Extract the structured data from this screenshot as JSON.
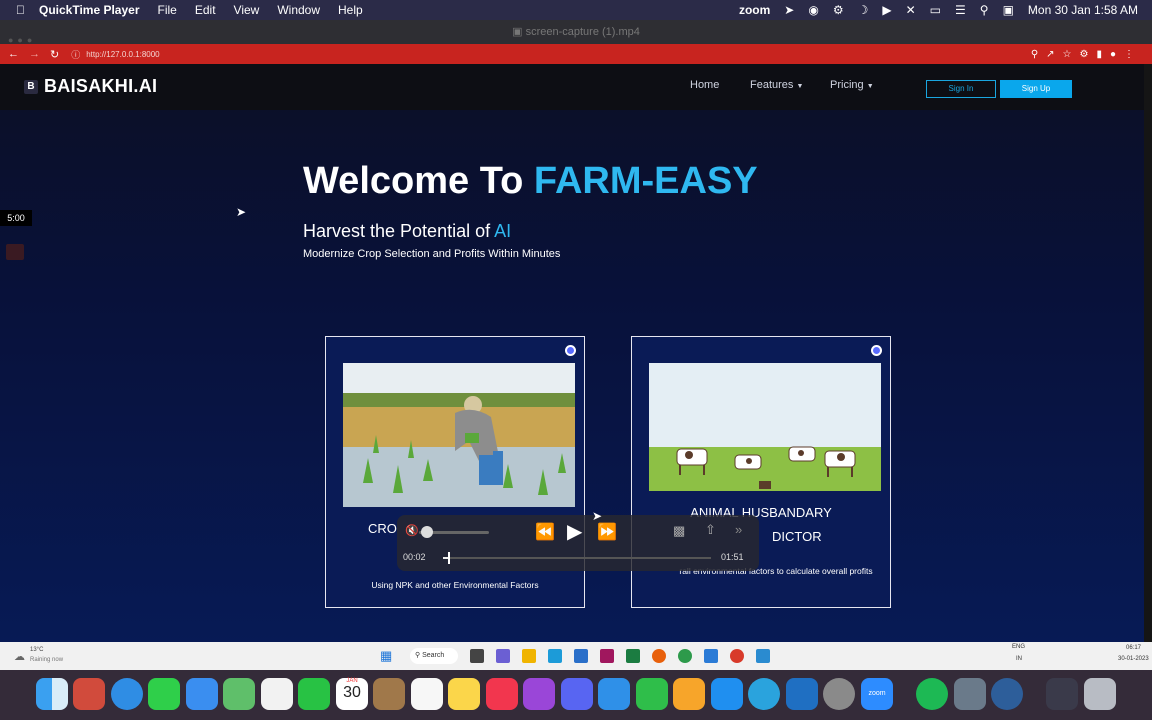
{
  "menubar": {
    "app_name": "QuickTime Player",
    "menus": [
      "File",
      "Edit",
      "View",
      "Window",
      "Help"
    ],
    "zoom_label": "zoom",
    "datetime": "Mon 30 Jan  1:58 AM"
  },
  "quicktime": {
    "file_title": "screen-capture (1).mp4"
  },
  "browser": {
    "url": "http://127.0.0.1:8000"
  },
  "hud": {
    "time": "5:00"
  },
  "site": {
    "brand_initial": "B",
    "brand": "BAISAKHI.AI",
    "nav": {
      "home": "Home",
      "features": "Features",
      "pricing": "Pricing"
    },
    "signin": "Sign In",
    "signup": "Sign Up",
    "hero_title_prefix": "Welcome To ",
    "hero_title_accent": "FARM-EASY",
    "hero_sub_prefix": "Harvest the Potential of ",
    "hero_sub_accent": "AI",
    "hero_desc": "Modernize Crop Selection and Profits Within Minutes",
    "cards": [
      {
        "title": "CRO",
        "desc": "Using NPK and other Environmental Factors"
      },
      {
        "title_line1": "ANIMAL HUSBANDARY",
        "title_line2": "DICTOR",
        "desc": "rall environmental factors to calculate overall profits"
      }
    ]
  },
  "player": {
    "elapsed": "00:02",
    "remaining": "01:51",
    "progress": 0.02
  },
  "taskbar": {
    "weather_temp": "13°C",
    "weather_desc": "Raining now",
    "search": "Search",
    "lang_top": "ENG",
    "lang_bottom": "IN",
    "time": "06:17",
    "date": "30-01-2023"
  },
  "dock": {
    "calendar_month": "JAN",
    "calendar_day": "30",
    "zoom": "zoom"
  }
}
